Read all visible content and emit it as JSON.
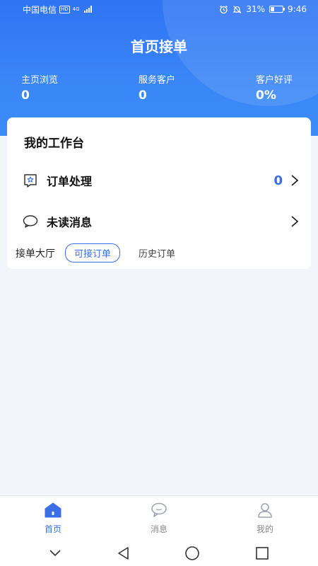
{
  "status_bar": {
    "carrier": "中国电信",
    "hd_badge": "HD",
    "network": "4G",
    "battery": "31%",
    "time": "9:46"
  },
  "header": {
    "title": "首页接单",
    "stats": [
      {
        "label": "主页浏览",
        "value": "0"
      },
      {
        "label": "服务客户",
        "value": "0"
      },
      {
        "label": "客户好评",
        "value": "0%"
      }
    ]
  },
  "workbench": {
    "title": "我的工作台",
    "rows": [
      {
        "label": "订单处理",
        "count": "0",
        "icon": "star-flag-icon"
      },
      {
        "label": "未读消息",
        "icon": "chat-bubble-icon"
      }
    ]
  },
  "order_tabs": {
    "hall": "接单大厅",
    "available": "可接订单",
    "history": "历史订单"
  },
  "bottom_nav": [
    {
      "label": "首页",
      "icon": "home-icon",
      "active": true
    },
    {
      "label": "消息",
      "icon": "message-icon",
      "active": false
    },
    {
      "label": "我的",
      "icon": "profile-icon",
      "active": false
    }
  ],
  "colors": {
    "accent": "#3a6fe6",
    "header_blue": "#2f74f3",
    "background": "#f2f5f9"
  }
}
